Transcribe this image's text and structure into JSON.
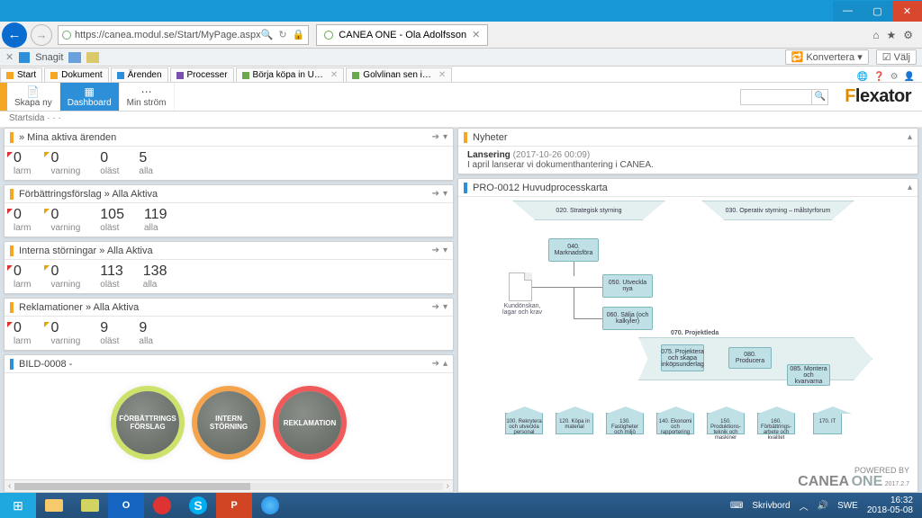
{
  "window": {
    "title_label": "CANEA ONE - Ola Adolfsson"
  },
  "ie": {
    "url_display": "https://canea.modul.se/Start/MyPage.aspx",
    "tab_label": "CANEA ONE - Ola Adolfsson",
    "snagit_label": "Snagit",
    "konvertera_label": "Konvertera",
    "valj_label": "Välj",
    "home_glyph": "⌂",
    "star_glyph": "★",
    "gear_glyph": "⚙"
  },
  "doctabs": [
    {
      "label": "Start",
      "color": "#f5a623"
    },
    {
      "label": "Dokument",
      "color": "#f5a623"
    },
    {
      "label": "Ärenden",
      "color": "#2d8fd8"
    },
    {
      "label": "Processer",
      "color": "#7b4fb0"
    },
    {
      "label": "Börja köpa in U…",
      "color": "#6aa84f"
    },
    {
      "label": "Golvlinan sen i…",
      "color": "#6aa84f"
    }
  ],
  "ribbon": {
    "skapa_label": "Skapa ny",
    "dashboard_label": "Dashboard",
    "minstrom_label": "Min ström",
    "search_placeholder": ""
  },
  "brand": "Flexator",
  "breadcrumb": "Startsida  ·  ·  ·",
  "panels": {
    "aktiva": {
      "title": "» Mina aktiva ärenden",
      "counters": [
        {
          "value": "0",
          "label": "larm",
          "cls": "red"
        },
        {
          "value": "0",
          "label": "varning",
          "cls": "yel"
        },
        {
          "value": "0",
          "label": "oläst",
          "cls": ""
        },
        {
          "value": "5",
          "label": "alla",
          "cls": ""
        }
      ]
    },
    "forbattring": {
      "title": "Förbättringsförslag » Alla Aktiva",
      "counters": [
        {
          "value": "0",
          "label": "larm",
          "cls": "red"
        },
        {
          "value": "0",
          "label": "varning",
          "cls": "yel"
        },
        {
          "value": "105",
          "label": "oläst",
          "cls": ""
        },
        {
          "value": "119",
          "label": "alla",
          "cls": ""
        }
      ]
    },
    "interna": {
      "title": "Interna störningar » Alla Aktiva",
      "counters": [
        {
          "value": "0",
          "label": "larm",
          "cls": "red"
        },
        {
          "value": "0",
          "label": "varning",
          "cls": "yel"
        },
        {
          "value": "113",
          "label": "oläst",
          "cls": ""
        },
        {
          "value": "138",
          "label": "alla",
          "cls": ""
        }
      ]
    },
    "reklam": {
      "title": "Reklamationer » Alla Aktiva",
      "counters": [
        {
          "value": "0",
          "label": "larm",
          "cls": "red"
        },
        {
          "value": "0",
          "label": "varning",
          "cls": "yel"
        },
        {
          "value": "9",
          "label": "oläst",
          "cls": ""
        },
        {
          "value": "9",
          "label": "alla",
          "cls": ""
        }
      ]
    },
    "bild": {
      "title": "BILD-0008 -",
      "circles": [
        {
          "label": "FÖRBÄTTRINGS\nFÖRSLAG",
          "cls": "c-green"
        },
        {
          "label": "INTERN\nSTÖRNING",
          "cls": "c-orange"
        },
        {
          "label": "REKLAMATION",
          "cls": "c-red"
        }
      ]
    },
    "nyheter": {
      "title": "Nyheter",
      "item_title": "Lansering",
      "item_meta": "(2017-10-26 00:09)",
      "item_body": "I april lanserar vi dokumenthantering i CANEA."
    },
    "proc": {
      "title": "PRO-0012 Huvudprocesskarta"
    }
  },
  "process": {
    "top_left": "020. Strategisk styrning",
    "top_right": "030. Operativ styrning – målstyrforum",
    "b040": "040. Marknadsföra",
    "b050": "050. Utveckla nya",
    "b060": "060. Sälja (och kalkyler)",
    "doc_label": "Kundönskan, lagar och krav",
    "sec": "070. Projektleda",
    "b075": "075. Projektera och skapa inköpsunderlag",
    "b080": "080. Producera",
    "b085": "085. Montera och kvarvarna",
    "houses": [
      "100. Rekrytera och utveckla personal",
      "120. Köpa in material",
      "130. Fastigheter och miljö",
      "140. Ekonomi och rapportering",
      "150. Produktions-teknik och maskiner",
      "160. Förbättrings-arbete och kvalitet",
      "170. IT"
    ]
  },
  "footer": {
    "powered": "POWERED BY",
    "brand": "CANEA",
    "one": "ONE",
    "ver": "2017.2.7"
  },
  "taskbar": {
    "desk_label": "Skrivbord",
    "lang": "SWE",
    "time": "16:32",
    "date": "2018-05-08"
  }
}
